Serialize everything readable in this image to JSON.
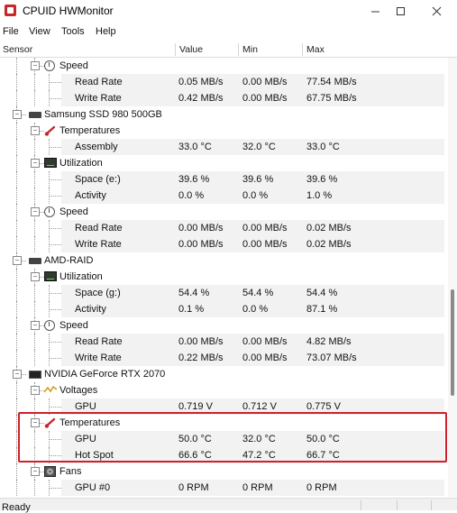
{
  "window": {
    "title": "CPUID HWMonitor"
  },
  "menu": [
    "File",
    "View",
    "Tools",
    "Help"
  ],
  "columns": {
    "sensor": "Sensor",
    "value": "Value",
    "min": "Min",
    "max": "Max"
  },
  "rows": [
    {
      "label": "Speed",
      "icon": "speed-icon",
      "level": 2
    },
    {
      "label": "Read Rate",
      "value": "0.05 MB/s",
      "min": "0.00 MB/s",
      "max": "77.54 MB/s",
      "level": 3
    },
    {
      "label": "Write Rate",
      "value": "0.42 MB/s",
      "min": "0.00 MB/s",
      "max": "67.75 MB/s",
      "level": 3
    },
    {
      "label": "Samsung SSD 980 500GB",
      "icon": "drive-icon",
      "level": 1
    },
    {
      "label": "Temperatures",
      "icon": "thermometer-icon",
      "level": 2
    },
    {
      "label": "Assembly",
      "value": "33.0 °C",
      "min": "32.0 °C",
      "max": "33.0 °C",
      "level": 3
    },
    {
      "label": "Utilization",
      "icon": "utilization-icon",
      "level": 2
    },
    {
      "label": "Space (e:)",
      "value": "39.6 %",
      "min": "39.6 %",
      "max": "39.6 %",
      "level": 3
    },
    {
      "label": "Activity",
      "value": "0.0 %",
      "min": "0.0 %",
      "max": "1.0 %",
      "level": 3
    },
    {
      "label": "Speed",
      "icon": "speed-icon",
      "level": 2
    },
    {
      "label": "Read Rate",
      "value": "0.00 MB/s",
      "min": "0.00 MB/s",
      "max": "0.02 MB/s",
      "level": 3
    },
    {
      "label": "Write Rate",
      "value": "0.00 MB/s",
      "min": "0.00 MB/s",
      "max": "0.02 MB/s",
      "level": 3
    },
    {
      "label": "AMD-RAID",
      "icon": "drive-icon",
      "level": 1
    },
    {
      "label": "Utilization",
      "icon": "utilization-icon",
      "level": 2
    },
    {
      "label": "Space (g:)",
      "value": "54.4 %",
      "min": "54.4 %",
      "max": "54.4 %",
      "level": 3
    },
    {
      "label": "Activity",
      "value": "0.1 %",
      "min": "0.0 %",
      "max": "87.1 %",
      "level": 3
    },
    {
      "label": "Speed",
      "icon": "speed-icon",
      "level": 2
    },
    {
      "label": "Read Rate",
      "value": "0.00 MB/s",
      "min": "0.00 MB/s",
      "max": "4.82 MB/s",
      "level": 3
    },
    {
      "label": "Write Rate",
      "value": "0.22 MB/s",
      "min": "0.00 MB/s",
      "max": "73.07 MB/s",
      "level": 3
    },
    {
      "label": "NVIDIA GeForce RTX 2070",
      "icon": "gpu-icon",
      "level": 1
    },
    {
      "label": "Voltages",
      "icon": "voltage-icon",
      "level": 2
    },
    {
      "label": "GPU",
      "value": "0.719 V",
      "min": "0.712 V",
      "max": "0.775 V",
      "level": 3
    },
    {
      "label": "Temperatures",
      "icon": "thermometer-icon",
      "level": 2
    },
    {
      "label": "GPU",
      "value": "50.0 °C",
      "min": "32.0 °C",
      "max": "50.0 °C",
      "level": 3
    },
    {
      "label": "Hot Spot",
      "value": "66.6 °C",
      "min": "47.2 °C",
      "max": "66.7 °C",
      "level": 3
    },
    {
      "label": "Fans",
      "icon": "fan-icon",
      "level": 2
    },
    {
      "label": "GPU #0",
      "value": "0 RPM",
      "min": "0 RPM",
      "max": "0 RPM",
      "level": 3
    }
  ],
  "status": {
    "text": "Ready"
  },
  "colors": {
    "highlight": "#d0202a",
    "row_bg": "#f2f2f2"
  }
}
